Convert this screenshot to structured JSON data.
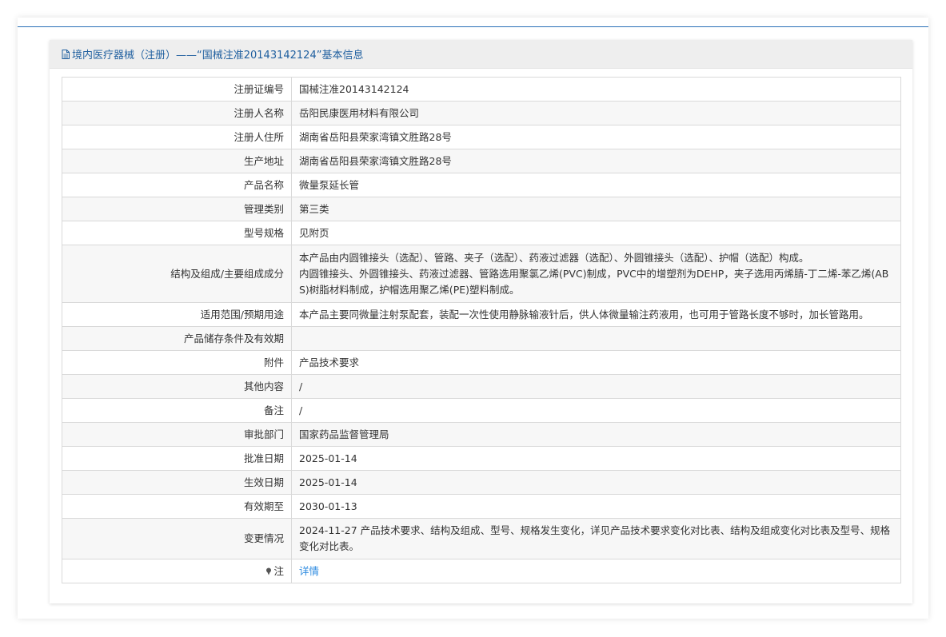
{
  "header": {
    "title": "境内医疗器械（注册）——“国械注准20143142124”基本信息"
  },
  "rows": [
    {
      "label": "注册证编号",
      "value": "国械注准20143142124"
    },
    {
      "label": "注册人名称",
      "value": "岳阳民康医用材料有限公司"
    },
    {
      "label": "注册人住所",
      "value": "湖南省岳阳县荣家湾镇文胜路28号"
    },
    {
      "label": "生产地址",
      "value": "湖南省岳阳县荣家湾镇文胜路28号"
    },
    {
      "label": "产品名称",
      "value": "微量泵延长管"
    },
    {
      "label": "管理类别",
      "value": "第三类"
    },
    {
      "label": "型号规格",
      "value": "见附页"
    },
    {
      "label": "结构及组成/主要组成成分",
      "value_lines": [
        "本产品由内圆锥接头（选配）、管路、夹子（选配）、药液过滤器（选配）、外圆锥接头（选配）、护帽（选配）构成。",
        "内圆锥接头、外圆锥接头、药液过滤器、管路选用聚氯乙烯(PVC)制成，PVC中的增塑剂为DEHP，夹子选用丙烯腈-丁二烯-苯乙烯(AB",
        "S)树脂材料制成，护帽选用聚乙烯(PE)塑料制成。"
      ]
    },
    {
      "label": "适用范围/预期用途",
      "value": "本产品主要同微量注射泵配套，装配一次性使用静脉输液针后，供人体微量输注药液用，也可用于管路长度不够时，加长管路用。"
    },
    {
      "label": "产品储存条件及有效期",
      "value": ""
    },
    {
      "label": "附件",
      "value": "产品技术要求"
    },
    {
      "label": "其他内容",
      "value": "/"
    },
    {
      "label": "备注",
      "value": "/"
    },
    {
      "label": "审批部门",
      "value": "国家药品监督管理局"
    },
    {
      "label": "批准日期",
      "value": "2025-01-14"
    },
    {
      "label": "生效日期",
      "value": "2025-01-14"
    },
    {
      "label": "有效期至",
      "value": "2030-01-13"
    },
    {
      "label": "变更情况",
      "value_lines": [
        "2024-11-27 产品技术要求、结构及组成、型号、规格发生变化，详见产品技术要求变化对比表、结构及组成变化对比表及型号、规格",
        "变化对比表。"
      ]
    },
    {
      "label": "注",
      "link": "详情"
    }
  ],
  "icons": {
    "header_icon": "document-icon",
    "note_icon": "pin-icon"
  },
  "colors": {
    "accent": "#2a6fb7",
    "header_text": "#1f5f9f",
    "link": "#2b8ae0"
  }
}
